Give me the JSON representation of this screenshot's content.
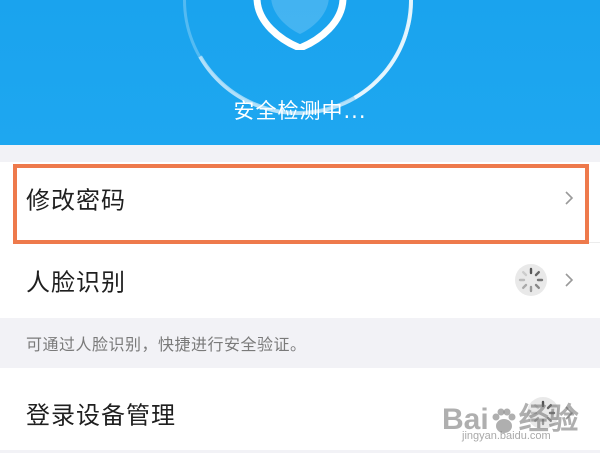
{
  "header": {
    "status_text": "安全检测中..."
  },
  "menu": {
    "items": [
      {
        "label": "修改密码"
      },
      {
        "label": "人脸识别"
      },
      {
        "label": "登录设备管理"
      }
    ]
  },
  "hint": {
    "text": "可通过人脸识别，快捷进行安全验证。"
  },
  "watermark": {
    "main_prefix": "Bai",
    "main_suffix": "经验",
    "sub": "jingyan.baidu.com"
  },
  "colors": {
    "header_bg": "#1ea7f0",
    "highlight": "#ee7a4c",
    "page_bg": "#f2f2f6"
  },
  "icons": {
    "shield": "shield-icon",
    "chevron": "chevron-right-icon",
    "spinner": "loading-spinner-icon"
  }
}
